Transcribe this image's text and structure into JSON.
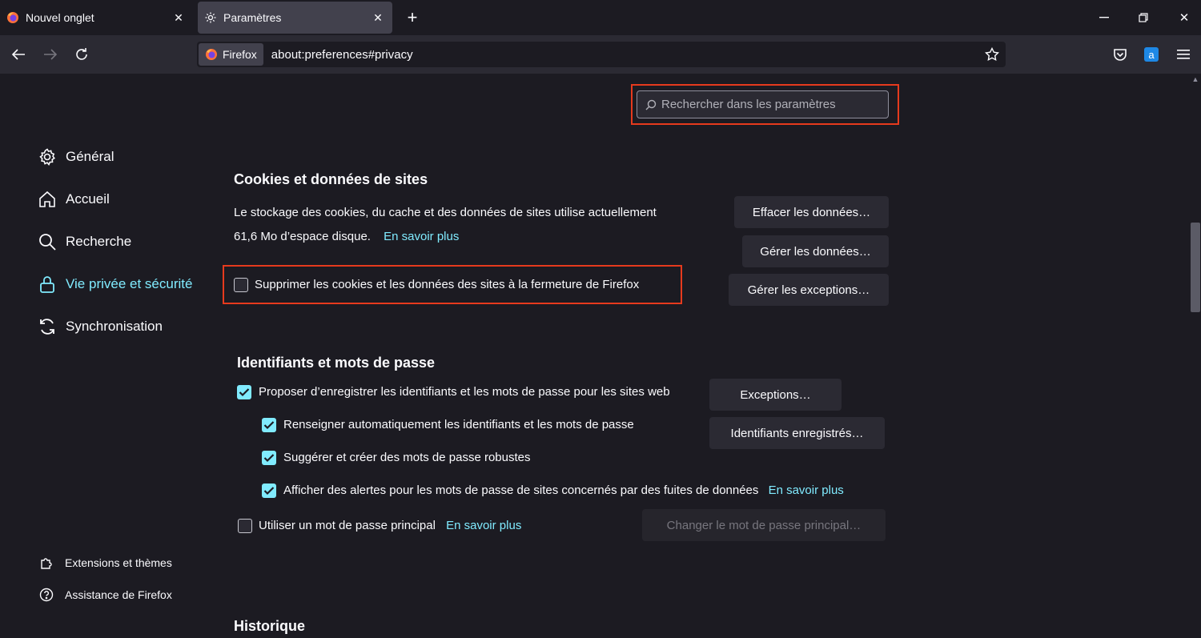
{
  "tabs": [
    {
      "label": "Nouvel onglet",
      "icon": "firefox-icon"
    },
    {
      "label": "Paramètres",
      "icon": "gear-icon"
    }
  ],
  "urlbar": {
    "identity_label": "Firefox",
    "url": "about:preferences#privacy"
  },
  "search": {
    "placeholder": "Rechercher dans les paramètres"
  },
  "sidebar": {
    "items": [
      {
        "label": "Général",
        "icon": "gear-icon"
      },
      {
        "label": "Accueil",
        "icon": "home-icon"
      },
      {
        "label": "Recherche",
        "icon": "search-icon"
      },
      {
        "label": "Vie privée et sécurité",
        "icon": "lock-icon",
        "active": true
      },
      {
        "label": "Synchronisation",
        "icon": "sync-icon"
      }
    ],
    "footer": [
      {
        "label": "Extensions et thèmes",
        "icon": "puzzle-icon"
      },
      {
        "label": "Assistance de Firefox",
        "icon": "help-icon"
      }
    ]
  },
  "cookies": {
    "heading": "Cookies et données de sites",
    "desc_line1": "Le stockage des cookies, du cache et des données de sites utilise actuellement",
    "desc_line2": "61,6 Mo d’espace disque.",
    "learn_more": "En savoir plus",
    "delete_on_close_label": "Supprimer les cookies et les données des sites à la fermeture de Firefox",
    "delete_on_close_checked": false,
    "btn_clear": "Effacer les données…",
    "btn_manage": "Gérer les données…",
    "btn_exceptions": "Gérer les exceptions…"
  },
  "logins": {
    "heading": "Identifiants et mots de passe",
    "offer_save_label": "Proposer d’enregistrer les identifiants et les mots de passe pour les sites web",
    "offer_save_checked": true,
    "autofill_label": "Renseigner automatiquement les identifiants et les mots de passe",
    "autofill_checked": true,
    "suggest_label": "Suggérer et créer des mots de passe robustes",
    "suggest_checked": true,
    "breach_label": "Afficher des alertes pour les mots de passe de sites concernés par des fuites de données",
    "breach_checked": true,
    "breach_learn_more": "En savoir plus",
    "primary_pw_label": "Utiliser un mot de passe principal",
    "primary_pw_checked": false,
    "primary_pw_learn_more": "En savoir plus",
    "btn_exceptions": "Exceptions…",
    "btn_saved_logins": "Identifiants enregistrés…",
    "btn_change_primary": "Changer le mot de passe principal…"
  },
  "history": {
    "heading": "Historique"
  },
  "colors": {
    "accent": "#80ebff",
    "highlight": "#e63a1d",
    "background": "#1c1b22"
  }
}
